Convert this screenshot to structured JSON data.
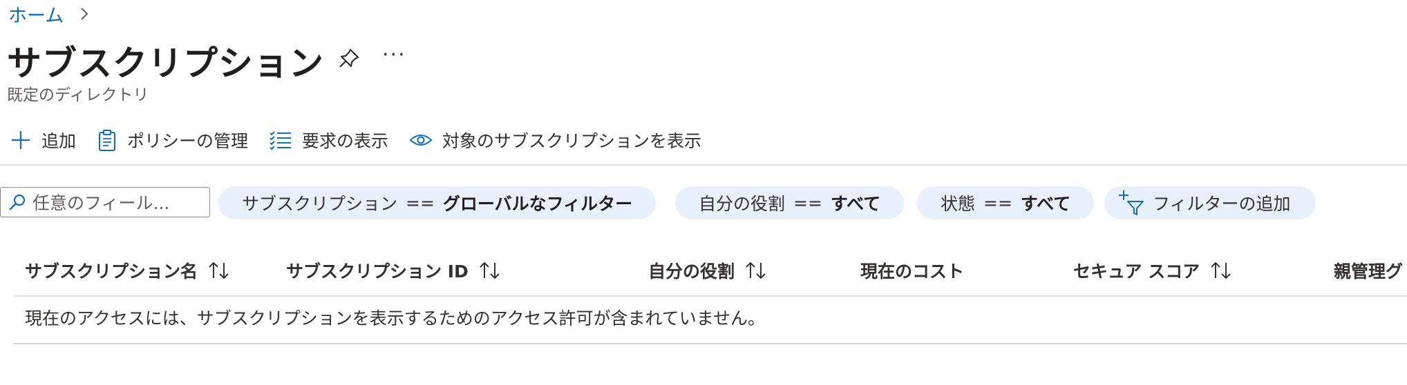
{
  "breadcrumb": {
    "home": "ホーム"
  },
  "header": {
    "title": "サブスクリプション",
    "subtitle": "既定のディレクトリ",
    "more": "···"
  },
  "toolbar": {
    "add": "追加",
    "manage_policies": "ポリシーの管理",
    "view_requests": "要求の表示",
    "view_eligible": "対象のサブスクリプションを表示"
  },
  "filters": {
    "search_placeholder": "任意のフィール...",
    "subscription": {
      "label": "サブスクリプション",
      "op": "==",
      "value": "グローバルなフィルター"
    },
    "role": {
      "label": "自分の役割",
      "op": "==",
      "value": "すべて"
    },
    "state": {
      "label": "状態",
      "op": "==",
      "value": "すべて"
    },
    "add_filter": "フィルターの追加"
  },
  "table": {
    "columns": [
      "サブスクリプション名",
      "サブスクリプション ID",
      "自分の役割",
      "現在のコスト",
      "セキュア スコア",
      "親管理グ"
    ],
    "empty_message": "現在のアクセスには、サブスクリプションを表示するためのアクセス許可が含まれていません。"
  },
  "colors": {
    "accent": "#0f6cbd",
    "pill_bg": "#e8f1fb",
    "divider": "#e1dfdd"
  }
}
